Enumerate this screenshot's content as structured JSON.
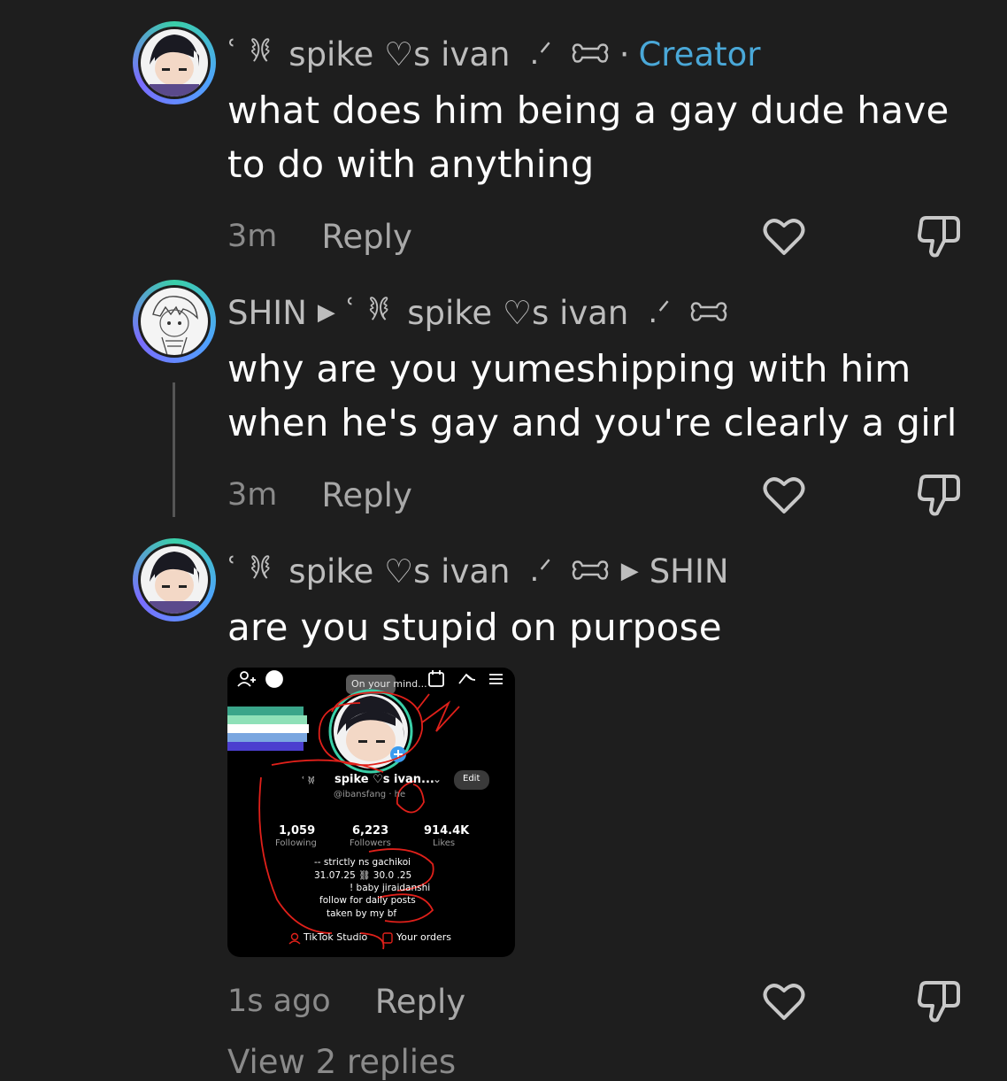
{
  "comments": [
    {
      "deco": "ʿ 𐦍",
      "author": "spike ♡s ivan",
      "post": ".ᐟ",
      "creator_label": "Creator",
      "text": "what does him being a gay dude have to do with anything",
      "time": "3m",
      "reply_label": "Reply"
    },
    {
      "author": "SHIN",
      "reply_to_deco": "ʿ 𐦍",
      "reply_to": "spike ♡s ivan",
      "reply_to_post": ".ᐟ",
      "text": "why are you yumeshipping with him when he's gay and you're clearly a girl",
      "time": "3m",
      "reply_label": "Reply"
    },
    {
      "deco": "ʿ 𐦍",
      "author": "spike ♡s ivan",
      "post": ".ᐟ",
      "reply_to": "SHIN",
      "text": "are you stupid on purpose",
      "time": "1s ago",
      "reply_label": "Reply"
    }
  ],
  "attachment": {
    "tooltip": "On your mind...",
    "username": "spike ♡s ivan...",
    "edit_label": "Edit",
    "handle": "@ibansfang · he",
    "stats": [
      {
        "value": "1,059",
        "label": "Following"
      },
      {
        "value": "6,223",
        "label": "Followers"
      },
      {
        "value": "914.4K",
        "label": "Likes"
      }
    ],
    "bio": [
      "-- strictly ns gachikoi",
      "31.07.25 ⛓ 30.0 .25",
      "! baby jiraidanshi",
      "follow for daily posts",
      "taken by my bf"
    ],
    "studio_label": "TikTok Studio",
    "orders_label": "Your orders"
  },
  "view_more": "View 2 replies",
  "colors": {
    "creator": "#4aa8d8",
    "background": "#1e1e1e",
    "annotation": "#e0201a"
  }
}
